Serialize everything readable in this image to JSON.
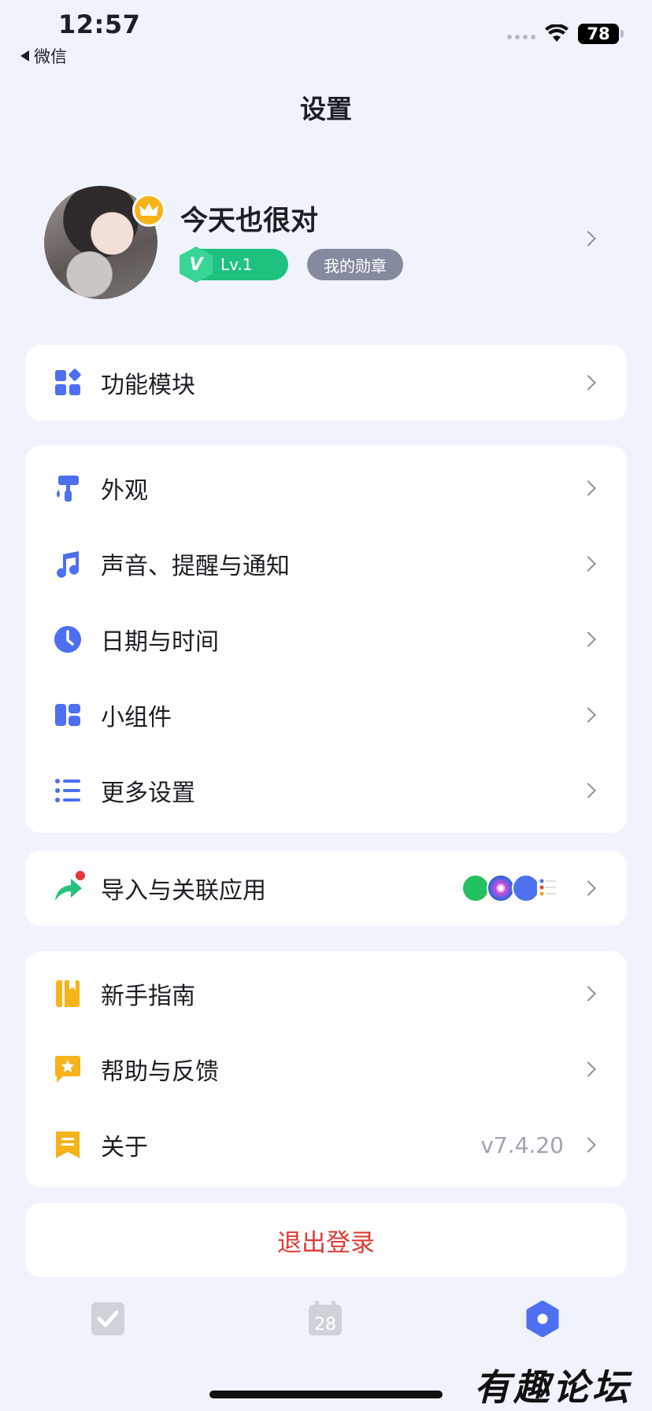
{
  "status_bar": {
    "time": "12:57",
    "back_app": "微信",
    "battery": "78"
  },
  "page_title": "设置",
  "profile": {
    "name": "今天也很对",
    "level_icon": "V",
    "level": "Lv.1",
    "medal": "我的勋章"
  },
  "modules": {
    "label": "功能模块"
  },
  "general": {
    "appearance": "外观",
    "sound": "声音、提醒与通知",
    "datetime": "日期与时间",
    "widgets": "小组件",
    "more": "更多设置"
  },
  "import": {
    "label": "导入与关联应用"
  },
  "help": {
    "guide": "新手指南",
    "feedback": "帮助与反馈",
    "about": "关于",
    "version": "v7.4.20"
  },
  "logout": "退出登录",
  "tabs": {
    "calendar_day": "28"
  },
  "watermark": "有趣论坛",
  "colors": {
    "accent": "#4d6ff0",
    "orange": "#f7b31c",
    "logout_red": "#de3b35",
    "level_green": "#1fc17f"
  }
}
